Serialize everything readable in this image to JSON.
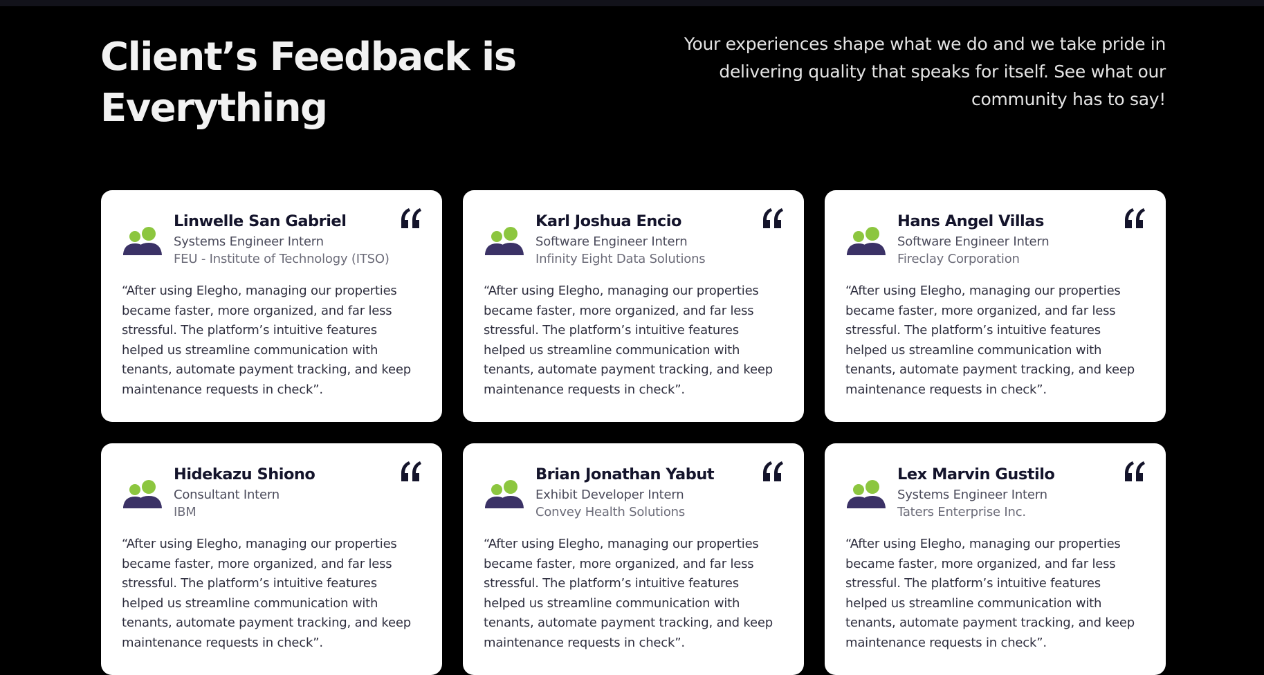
{
  "header": {
    "title": "Client’s Feedback is Everything",
    "subtitle": "Your experiences shape what we do and we take pride in delivering quality that speaks for itself. See what our community has to say!"
  },
  "icons": {
    "avatar": "users-group-icon",
    "quote": "quote-open-icon"
  },
  "colors": {
    "background": "#000000",
    "card": "#ffffff",
    "avatar_accent": "#8cc63f",
    "avatar_primary": "#3b3266",
    "text_dark": "#14142b"
  },
  "testimonials": [
    {
      "name": "Linwelle San Gabriel",
      "role": "Systems Engineer Intern",
      "company": "FEU - Institute of Technology (ITSO)",
      "quote": "“After using Elegho, managing our properties became faster, more organized, and far less stressful. The platform’s intuitive features helped us streamline communication with tenants, automate payment tracking, and keep maintenance requests in check”."
    },
    {
      "name": "Karl Joshua Encio",
      "role": "Software Engineer Intern",
      "company": "Infinity Eight Data Solutions",
      "quote": "“After using Elegho, managing our properties became faster, more organized, and far less stressful. The platform’s intuitive features helped us streamline communication with tenants, automate payment tracking, and keep maintenance requests in check”."
    },
    {
      "name": "Hans Angel Villas",
      "role": "Software Engineer Intern",
      "company": "Fireclay Corporation",
      "quote": "“After using Elegho, managing our properties became faster, more organized, and far less stressful. The platform’s intuitive features helped us streamline communication with tenants, automate payment tracking, and keep maintenance requests in check”."
    },
    {
      "name": "Hidekazu Shiono",
      "role": "Consultant Intern",
      "company": "IBM",
      "quote": "“After using Elegho, managing our properties became faster, more organized, and far less stressful. The platform’s intuitive features helped us streamline communication with tenants, automate payment tracking, and keep maintenance requests in check”."
    },
    {
      "name": "Brian Jonathan Yabut",
      "role": "Exhibit Developer Intern",
      "company": "Convey Health Solutions",
      "quote": "“After using Elegho, managing our properties became faster, more organized, and far less stressful. The platform’s intuitive features helped us streamline communication with tenants, automate payment tracking, and keep maintenance requests in check”."
    },
    {
      "name": "Lex Marvin Gustilo",
      "role": "Systems Engineer Intern",
      "company": "Taters Enterprise Inc.",
      "quote": "“After using Elegho, managing our properties became faster, more organized, and far less stressful. The platform’s intuitive features helped us streamline communication with tenants, automate payment tracking, and keep maintenance requests in check”."
    }
  ]
}
